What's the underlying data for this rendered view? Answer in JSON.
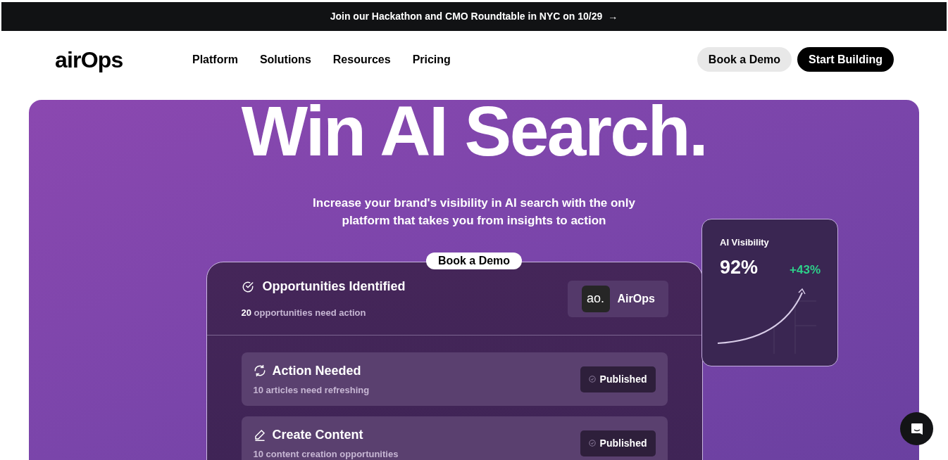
{
  "banner": {
    "text": "Join our Hackathon and CMO Roundtable in NYC on 10/29",
    "arrow": "→"
  },
  "nav": {
    "logo": "airOps",
    "links": [
      "Platform",
      "Solutions",
      "Resources",
      "Pricing"
    ],
    "buttons": [
      {
        "label": "Book a Demo",
        "kind": "secondary"
      },
      {
        "label": "Start Building",
        "kind": "primary"
      }
    ]
  },
  "hero": {
    "title": "Win AI Search.",
    "subtitle": "Increase your brand's visibility in AI search with the only platform that takes you from insights to action",
    "cta": "Book a Demo",
    "panel": {
      "title": "Opportunities Identified",
      "summary": "**20** opportunities need action",
      "brand": {
        "mark": "ao.",
        "name": "AirOps"
      },
      "rows": [
        {
          "kind": "refresh",
          "title": "Action Needed",
          "detail": "**10** articles need refreshing",
          "status": "Published"
        },
        {
          "kind": "create",
          "title": "Create Content",
          "detail": "**10** content creation opportunities",
          "status": "Published"
        }
      ]
    },
    "metric": {
      "label": "AI Visibility",
      "value": "92%",
      "change": "+43%"
    }
  }
}
